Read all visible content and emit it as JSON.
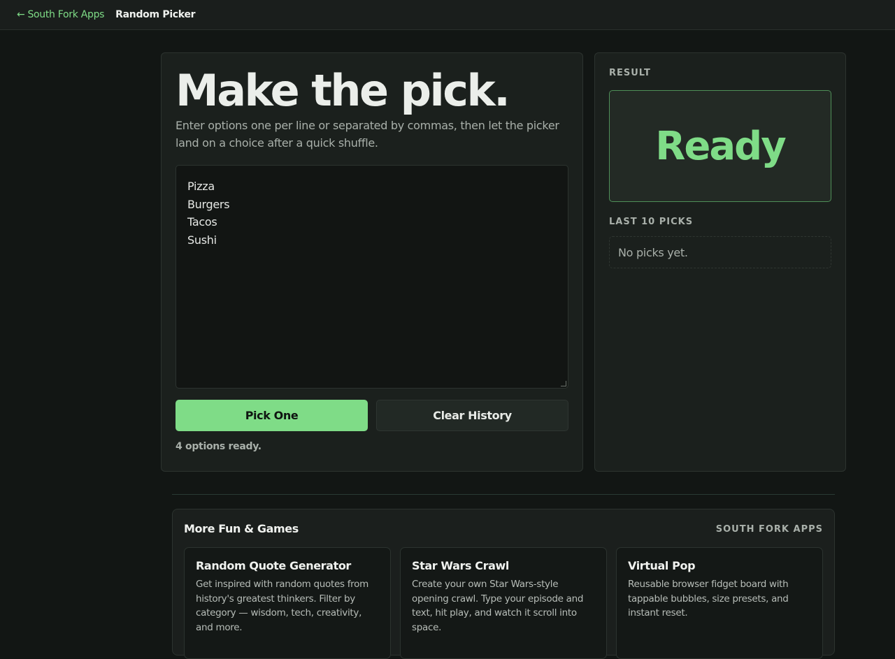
{
  "topbar": {
    "back_icon": "left-arrow-icon",
    "back_arrow": "←",
    "back_label": "South Fork Apps",
    "page_title": "Random Picker"
  },
  "main": {
    "headline": "Make the pick.",
    "subtext": "Enter options one per line or separated by commas, then let the picker land on a choice after a quick shuffle.",
    "options_value": "Pizza\nBurgers\nTacos\nSushi",
    "pick_button": "Pick One",
    "clear_button": "Clear History",
    "status": "4 options ready."
  },
  "side": {
    "result_label": "RESULT",
    "result_value": "Ready",
    "history_label": "LAST 10 PICKS",
    "history_empty": "No picks yet."
  },
  "more": {
    "title": "More Fun & Games",
    "brand": "SOUTH FORK APPS",
    "cards": [
      {
        "title": "Random Quote Generator",
        "desc": "Get inspired with random quotes from history's greatest thinkers. Filter by category — wisdom, tech, creativity, and more."
      },
      {
        "title": "Star Wars Crawl",
        "desc": "Create your own Star Wars-style opening crawl. Type your episode and text, hit play, and watch it scroll into space."
      },
      {
        "title": "Virtual Pop",
        "desc": "Reusable browser fidget board with tappable bubbles, size presets, and instant reset."
      }
    ]
  },
  "colors": {
    "accent": "#7fdc87",
    "background": "#121614",
    "panel": "#1b201d"
  }
}
